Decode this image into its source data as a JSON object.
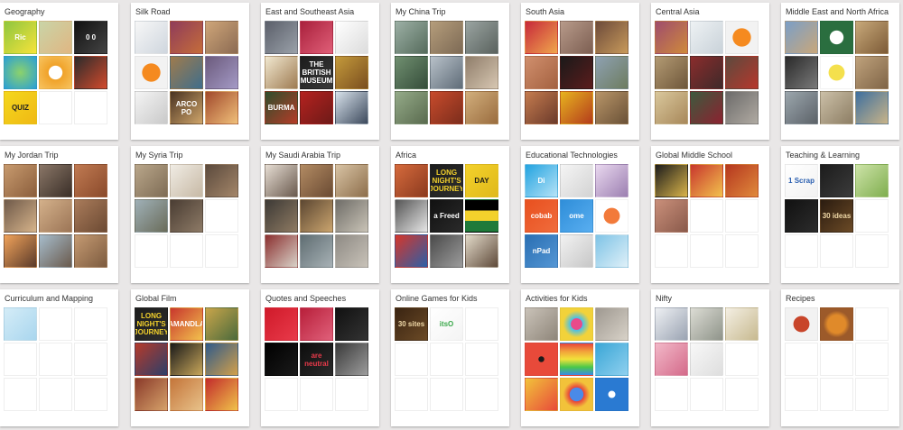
{
  "boards": [
    {
      "title": "Geography",
      "thumbs": [
        {
          "bg": "linear-gradient(135deg,#8ec63f,#f7e33a)",
          "text": "Ric",
          "color": "#ffffff"
        },
        {
          "bg": "linear-gradient(135deg,#c9d4a7,#e0b682)"
        },
        {
          "bg": "linear-gradient(135deg,#111111,#444444)",
          "text": "0 0",
          "color": "#ffffff"
        },
        {
          "bg": "radial-gradient(circle,#8cd26b,#2a9fd6)"
        },
        {
          "bg": "radial-gradient(circle,#ffffff 30%,#f0a229 32%,#f7c35f)"
        },
        {
          "bg": "linear-gradient(135deg,#2b2b2b,#d24a2d)"
        },
        {
          "bg": "linear-gradient(135deg,#f4d71d,#f0b914)",
          "text": "QUIZ",
          "color": "#222222"
        },
        {
          "bg": ""
        },
        {
          "bg": ""
        }
      ]
    },
    {
      "title": "Silk Road",
      "thumbs": [
        {
          "bg": "linear-gradient(135deg,#f7f7f7,#cfd6de)"
        },
        {
          "bg": "linear-gradient(135deg,#8f3b5a,#c56d3a)"
        },
        {
          "bg": "linear-gradient(135deg,#cfa679,#8b6a52)"
        },
        {
          "bg": "radial-gradient(circle,#f58a1f 40%,#f2f2f2 42%)"
        },
        {
          "bg": "linear-gradient(135deg,#9f7b4c,#3f6e8c)"
        },
        {
          "bg": "linear-gradient(135deg,#6b5a7c,#a49ac6)"
        },
        {
          "bg": "linear-gradient(135deg,#f4f4f4,#c9c9c9)"
        },
        {
          "bg": "linear-gradient(135deg,#4a3322,#cfa56a)",
          "text": "ARCO PO",
          "color": "#ffffff"
        },
        {
          "bg": "linear-gradient(135deg,#a1492c,#f0c07a)"
        }
      ]
    },
    {
      "title": "East and Southeast Asia",
      "thumbs": [
        {
          "bg": "linear-gradient(135deg,#5b5f6a,#9aa1a9)"
        },
        {
          "bg": "linear-gradient(135deg,#a9203c,#e05f78)"
        },
        {
          "bg": "linear-gradient(135deg,#ffffff,#dcdcdc)"
        },
        {
          "bg": "linear-gradient(135deg,#f1e8d0,#9e7b52)"
        },
        {
          "bg": "linear-gradient(135deg,#1c1c1c,#3a3a3a)",
          "text": "THE BRITISH MUSEUM",
          "color": "#ffffff"
        },
        {
          "bg": "linear-gradient(135deg,#c49a3b,#7a4e1f)"
        },
        {
          "bg": "linear-gradient(135deg,#2f4d2c,#b53c28)",
          "text": "BURMA",
          "color": "#ffffff"
        },
        {
          "bg": "linear-gradient(135deg,#b4221f,#6e1a18)"
        },
        {
          "bg": "linear-gradient(135deg,#d7e1ea,#3d4a5d)"
        }
      ]
    },
    {
      "title": "My China Trip",
      "thumbs": [
        {
          "bg": "linear-gradient(135deg,#9cb0a5,#566b5c)"
        },
        {
          "bg": "linear-gradient(135deg,#b59d7b,#7d6a55)"
        },
        {
          "bg": "linear-gradient(135deg,#9aa4a1,#5a625e)"
        },
        {
          "bg": "linear-gradient(135deg,#708f70,#354d3a)"
        },
        {
          "bg": "linear-gradient(135deg,#b8c1c9,#5f6c78)"
        },
        {
          "bg": "linear-gradient(135deg,#8f7d6a,#d7c7b2)"
        },
        {
          "bg": "linear-gradient(135deg,#94aa88,#5a6b4f)"
        },
        {
          "bg": "linear-gradient(135deg,#c74b2c,#7c2d1c)"
        },
        {
          "bg": "linear-gradient(135deg,#d1ae7c,#9a6c3e)"
        }
      ]
    },
    {
      "title": "South Asia",
      "thumbs": [
        {
          "bg": "linear-gradient(135deg,#c7283a,#f0a74d)"
        },
        {
          "bg": "linear-gradient(135deg,#b79a8a,#7d5f52)"
        },
        {
          "bg": "linear-gradient(135deg,#6c4a3a,#c89a5b)"
        },
        {
          "bg": "linear-gradient(135deg,#d08f6d,#a46140)"
        },
        {
          "bg": "linear-gradient(135deg,#1a1a1a,#5b1c1c)"
        },
        {
          "bg": "linear-gradient(135deg,#8ea1b2,#6d7c5f)"
        },
        {
          "bg": "linear-gradient(135deg,#c47b4e,#6b3a2b)"
        },
        {
          "bg": "linear-gradient(135deg,#e7b31f,#b43c1c)"
        },
        {
          "bg": "linear-gradient(135deg,#b89568,#6a5137)"
        }
      ]
    },
    {
      "title": "Central Asia",
      "thumbs": [
        {
          "bg": "linear-gradient(135deg,#9f4c6d,#cf8a3b)"
        },
        {
          "bg": "linear-gradient(135deg,#eef2f4,#c9d2d9)"
        },
        {
          "bg": "radial-gradient(circle,#f58a1f 40%,#f2f2f2 42%)"
        },
        {
          "bg": "linear-gradient(135deg,#b39a73,#6e573a)"
        },
        {
          "bg": "linear-gradient(135deg,#8b2c2c,#3e2a2a)"
        },
        {
          "bg": "linear-gradient(135deg,#5c4a3e,#b7372c)"
        },
        {
          "bg": "linear-gradient(135deg,#d9c79c,#a8885a)"
        },
        {
          "bg": "linear-gradient(135deg,#3c5a3e,#8c2230)"
        },
        {
          "bg": "linear-gradient(135deg,#6c6b6a,#b0aaa2)"
        }
      ]
    },
    {
      "title": "Middle East and North Africa",
      "thumbs": [
        {
          "bg": "linear-gradient(135deg,#7b9fc7,#c9a77a)"
        },
        {
          "bg": "radial-gradient(circle,#ffffff 30%,#2a6e3f 32%)"
        },
        {
          "bg": "linear-gradient(135deg,#c8a97a,#7c5a36)"
        },
        {
          "bg": "linear-gradient(135deg,#2a2a2a,#7a7a7a)"
        },
        {
          "bg": "radial-gradient(circle,#f4e04d 35%,#ffffff 37%)"
        },
        {
          "bg": "linear-gradient(135deg,#bfa27c,#7f6446)"
        },
        {
          "bg": "linear-gradient(135deg,#9ba6ad,#5c6268)"
        },
        {
          "bg": "linear-gradient(135deg,#cbbfa7,#8d7e64)"
        },
        {
          "bg": "linear-gradient(135deg,#3e6f9f,#c9b488)"
        }
      ]
    },
    {
      "title": "My Jordan Trip",
      "thumbs": [
        {
          "bg": "linear-gradient(135deg,#c79a6e,#8b5e3c)"
        },
        {
          "bg": "linear-gradient(135deg,#8a7667,#3a2f28)"
        },
        {
          "bg": "linear-gradient(135deg,#c07a52,#8a4a2b)"
        },
        {
          "bg": "linear-gradient(135deg,#6f5a4a,#d6b38a)"
        },
        {
          "bg": "linear-gradient(135deg,#d3b08a,#9c7556)"
        },
        {
          "bg": "linear-gradient(135deg,#a97b5a,#6c4a33)"
        },
        {
          "bg": "linear-gradient(135deg,#f0a25a,#5a3a2a)"
        },
        {
          "bg": "linear-gradient(135deg,#a6bccb,#6a5a4d)"
        },
        {
          "bg": "linear-gradient(135deg,#c49a72,#7d5b3f)"
        }
      ]
    },
    {
      "title": "My Syria Trip",
      "thumbs": [
        {
          "bg": "linear-gradient(135deg,#b9a68a,#7e6c55)"
        },
        {
          "bg": "linear-gradient(135deg,#f0ece4,#c7b9a5)"
        },
        {
          "bg": "linear-gradient(135deg,#5b4a3d,#a48669)"
        },
        {
          "bg": "linear-gradient(135deg,#9fb0b7,#6a6c5a)"
        },
        {
          "bg": "linear-gradient(135deg,#4a3d33,#8d7a66)"
        },
        {
          "bg": ""
        },
        {
          "bg": ""
        },
        {
          "bg": ""
        },
        {
          "bg": ""
        }
      ]
    },
    {
      "title": "My Saudi Arabia Trip",
      "thumbs": [
        {
          "bg": "linear-gradient(135deg,#e6ddd3,#6a5a4e)"
        },
        {
          "bg": "linear-gradient(135deg,#b28b63,#6b4b33)"
        },
        {
          "bg": "linear-gradient(135deg,#d8c3a4,#8d6e4b)"
        },
        {
          "bg": "linear-gradient(135deg,#3d3a36,#8e7a62)"
        },
        {
          "bg": "linear-gradient(135deg,#5c4732,#caa46e)"
        },
        {
          "bg": "linear-gradient(135deg,#6f6d68,#c9c3b6)"
        },
        {
          "bg": "linear-gradient(135deg,#8b2f2f,#d8d2c8)"
        },
        {
          "bg": "linear-gradient(135deg,#5f6d72,#a7b1b5)"
        },
        {
          "bg": "linear-gradient(135deg,#8e8a84,#c8c2b8)"
        }
      ]
    },
    {
      "title": "Africa",
      "thumbs": [
        {
          "bg": "linear-gradient(135deg,#d56a3c,#8b3a1f)"
        },
        {
          "bg": "linear-gradient(135deg,#1c1c1c,#2e2e2e)",
          "text": "LONG NIGHT'S JOURNEY",
          "color": "#f3d12c"
        },
        {
          "bg": "linear-gradient(135deg,#f3d12c,#e0b91a)",
          "text": "DAY",
          "color": "#1a1a1a"
        },
        {
          "bg": "linear-gradient(135deg,#555555,#e6e6e6)"
        },
        {
          "bg": "linear-gradient(135deg,#111111,#2a2a2a)",
          "text": "a Freed",
          "color": "#ffffff"
        },
        {
          "bg": "linear-gradient(180deg,#000000 33%,#f3d12c 33%,#f3d12c 66%,#1f7a3a 66%)"
        },
        {
          "bg": "linear-gradient(135deg,#d6362a,#2b5fa8)"
        },
        {
          "bg": "linear-gradient(135deg,#4a4a4a,#9c9c9c)"
        },
        {
          "bg": "linear-gradient(135deg,#e2dac9,#5f4a3a)"
        }
      ]
    },
    {
      "title": "Educational Technologies",
      "thumbs": [
        {
          "bg": "linear-gradient(135deg,#23a3e0,#b6e3f7)",
          "text": "Di",
          "color": "#ffffff"
        },
        {
          "bg": "linear-gradient(135deg,#f5f5f5,#d3d3d3)"
        },
        {
          "bg": "linear-gradient(135deg,#e9d8ef,#9c7fb1)"
        },
        {
          "bg": "linear-gradient(135deg,#e8501f,#f06c3c)",
          "text": "cobab",
          "color": "#ffffff"
        },
        {
          "bg": "linear-gradient(135deg,#2f8ed9,#59aef0)",
          "text": "ome",
          "color": "#ffffff"
        },
        {
          "bg": "radial-gradient(circle,#f27a3a 35%,#ffffff 37%)"
        },
        {
          "bg": "linear-gradient(135deg,#2a6fb3,#5496d4)",
          "text": "nPad",
          "color": "#ffffff"
        },
        {
          "bg": "linear-gradient(135deg,#f2f2f2,#c7c7c7)"
        },
        {
          "bg": "linear-gradient(135deg,#7ec3e6,#dff0f8)"
        }
      ]
    },
    {
      "title": "Global Middle School",
      "thumbs": [
        {
          "bg": "linear-gradient(135deg,#1c1c1c,#d9b44a)"
        },
        {
          "bg": "linear-gradient(135deg,#c8372d,#f2c14d)"
        },
        {
          "bg": "linear-gradient(135deg,#b5371f,#e08a3c)"
        },
        {
          "bg": "linear-gradient(135deg,#c98f7a,#8a5a4b)"
        },
        {
          "bg": ""
        },
        {
          "bg": ""
        },
        {
          "bg": ""
        },
        {
          "bg": ""
        },
        {
          "bg": ""
        }
      ]
    },
    {
      "title": "Teaching & Learning",
      "thumbs": [
        {
          "bg": "linear-gradient(135deg,#ffffff,#f2f2f2)",
          "text": "1 Scrap",
          "color": "#2a5fb0"
        },
        {
          "bg": "linear-gradient(135deg,#1c1c1c,#3b3b3b)"
        },
        {
          "bg": "linear-gradient(135deg,#cde3a8,#7fae4e)"
        },
        {
          "bg": "linear-gradient(135deg,#111111,#2c2c2c)"
        },
        {
          "bg": "linear-gradient(135deg,#2b1c10,#6b4a26)",
          "text": "30 ideas",
          "color": "#f0d9a8"
        },
        {
          "bg": ""
        },
        {
          "bg": ""
        },
        {
          "bg": ""
        },
        {
          "bg": ""
        }
      ]
    },
    {
      "title": "Curriculum and Mapping",
      "thumbs": [
        {
          "bg": "linear-gradient(135deg,#d4ecf7,#a9d6ee)"
        },
        {
          "bg": ""
        },
        {
          "bg": ""
        },
        {
          "bg": ""
        },
        {
          "bg": ""
        },
        {
          "bg": ""
        },
        {
          "bg": ""
        },
        {
          "bg": ""
        },
        {
          "bg": ""
        }
      ]
    },
    {
      "title": "Global Film",
      "thumbs": [
        {
          "bg": "linear-gradient(135deg,#1c1c1c,#2e2e2e)",
          "text": "LONG NIGHT'S JOURNEY",
          "color": "#f3d12c"
        },
        {
          "bg": "linear-gradient(135deg,#c8372d,#f2c14d)",
          "text": "AMANDLA",
          "color": "#ffffff"
        },
        {
          "bg": "linear-gradient(135deg,#c9a54a,#4a6a3c)"
        },
        {
          "bg": "linear-gradient(135deg,#b53a2a,#2c3f6a)"
        },
        {
          "bg": "linear-gradient(135deg,#1a1a1a,#c7a65a)"
        },
        {
          "bg": "linear-gradient(135deg,#2f5a8a,#d2a04a)"
        },
        {
          "bg": "linear-gradient(135deg,#8a3a2a,#d6a26a)"
        },
        {
          "bg": "linear-gradient(135deg,#c4753a,#e8c28a)"
        },
        {
          "bg": "linear-gradient(135deg,#c22b2b,#f0c24a)"
        }
      ]
    },
    {
      "title": "Quotes and Speeches",
      "thumbs": [
        {
          "bg": "linear-gradient(135deg,#d01a2a,#e83a4a)"
        },
        {
          "bg": "linear-gradient(135deg,#b81f3a,#e0607a)"
        },
        {
          "bg": "linear-gradient(135deg,#111111,#333333)"
        },
        {
          "bg": "linear-gradient(135deg,#000000,#1a1a1a)"
        },
        {
          "bg": "linear-gradient(135deg,#0d0d0d,#2a2a2a)",
          "text": "are neutral",
          "color": "#e83a4a"
        },
        {
          "bg": "linear-gradient(135deg,#3a3a3a,#9c9c9c)"
        },
        {
          "bg": ""
        },
        {
          "bg": ""
        },
        {
          "bg": ""
        }
      ]
    },
    {
      "title": "Online Games for Kids",
      "thumbs": [
        {
          "bg": "linear-gradient(135deg,#3a2412,#6b4a26)",
          "text": "30 sites",
          "color": "#f0d9a8"
        },
        {
          "bg": "linear-gradient(135deg,#ffffff,#f4f4f4)",
          "text": "itsO",
          "color": "#3aa84a"
        },
        {
          "bg": ""
        },
        {
          "bg": ""
        },
        {
          "bg": ""
        },
        {
          "bg": ""
        },
        {
          "bg": ""
        },
        {
          "bg": ""
        },
        {
          "bg": ""
        }
      ]
    },
    {
      "title": "Activities for Kids",
      "thumbs": [
        {
          "bg": "linear-gradient(135deg,#c9c2b8,#8f867a)"
        },
        {
          "bg": "radial-gradient(circle,#e84a8a 25%,#4ac0e8 27%,#f2d23a 60%)"
        },
        {
          "bg": "linear-gradient(135deg,#9e9890,#d8d2c8)"
        },
        {
          "bg": "radial-gradient(circle,#1a1a1a 12%,#e84a3a 14%)"
        },
        {
          "bg": "linear-gradient(180deg,#e8433a,#f2a23a,#f2e23a,#4ac84a,#3a8ae8)"
        },
        {
          "bg": "linear-gradient(135deg,#3aa6d6,#8fd0ef)"
        },
        {
          "bg": "linear-gradient(135deg,#f2c23a,#e84a3a)"
        },
        {
          "bg": "radial-gradient(circle,#4a8ae8 30%,#e8433a 32%,#f2c23a 60%)"
        },
        {
          "bg": "radial-gradient(circle,#ffffff 15%,#2a7ad2 17%)"
        }
      ]
    },
    {
      "title": "Nifty",
      "thumbs": [
        {
          "bg": "linear-gradient(135deg,#eef0f3,#9aa3b2)"
        },
        {
          "bg": "linear-gradient(135deg,#dcdcd4,#8f948a)"
        },
        {
          "bg": "linear-gradient(135deg,#f4efe3,#c7b98f)"
        },
        {
          "bg": "linear-gradient(135deg,#f2b8c8,#d46a8a)"
        },
        {
          "bg": "linear-gradient(135deg,#f8f8f8,#dedede)"
        },
        {
          "bg": ""
        },
        {
          "bg": ""
        },
        {
          "bg": ""
        },
        {
          "bg": ""
        }
      ]
    },
    {
      "title": "Recipes",
      "thumbs": [
        {
          "bg": "radial-gradient(circle,#c8452a 35%,#f2f2f2 37%)"
        },
        {
          "bg": "radial-gradient(circle,#e08a2a 40%,#9c5a2a 60%)"
        },
        {
          "bg": ""
        },
        {
          "bg": ""
        },
        {
          "bg": ""
        },
        {
          "bg": ""
        },
        {
          "bg": ""
        },
        {
          "bg": ""
        },
        {
          "bg": ""
        }
      ]
    }
  ]
}
